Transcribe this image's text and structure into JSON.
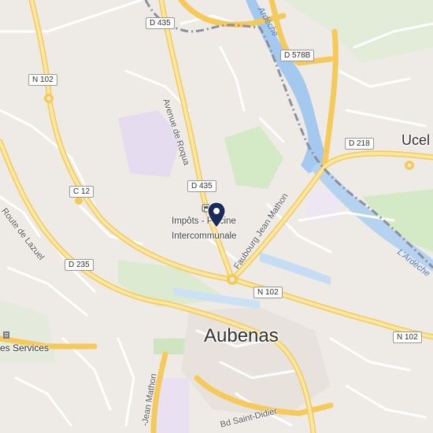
{
  "map": {
    "route_shields": [
      "D 435",
      "D 578B",
      "N 102",
      "C 12",
      "D 435",
      "D 235",
      "D 218",
      "N 102",
      "N 102"
    ],
    "road_names": [
      "Avenue de Roqua",
      "Route de Lazuel",
      "Faubourg Jean Mathon",
      "Bd Saint-Didier",
      "-Jean Mathon"
    ],
    "water_names": [
      "Ardèche",
      "L'Ardèche"
    ],
    "places": {
      "town": "Aubenas",
      "ucel": "Ucel",
      "services": "es Services"
    },
    "poi": {
      "line1": "Impôts - Piscine",
      "line2": "Intercommunale",
      "marker_icon": "location-pin-icon",
      "transit_icon": "bus-stop-icon"
    },
    "colors": {
      "background": "#eeebe6",
      "major_road": "#f7d67c",
      "minor_road": "#ffffff",
      "water": "#a4c8ee",
      "park": "#d4e9c6",
      "industrial": "#e6dcf0",
      "rail": "#8b8fa0",
      "marker": "#1a2a5a"
    }
  }
}
